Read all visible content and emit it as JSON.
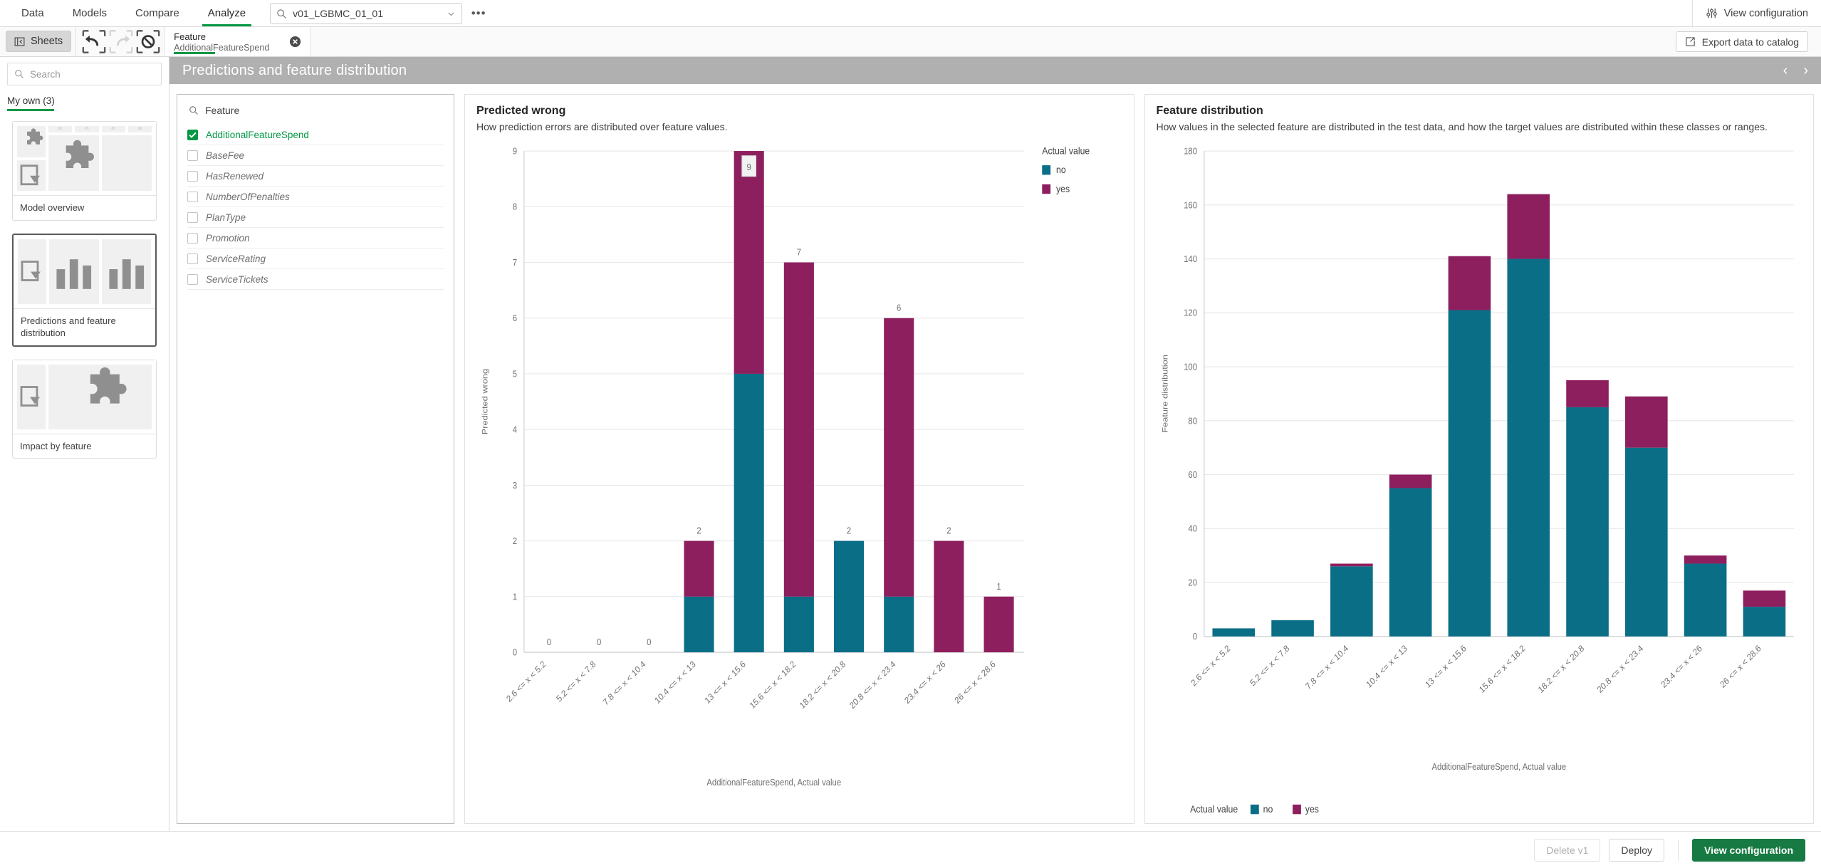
{
  "topbar": {
    "tabs": [
      {
        "label": "Data",
        "active": false
      },
      {
        "label": "Models",
        "active": false
      },
      {
        "label": "Compare",
        "active": false
      },
      {
        "label": "Analyze",
        "active": true
      }
    ],
    "model_select_value": "v01_LGBMC_01_01",
    "more_label": "•••",
    "view_configuration_label": "View configuration"
  },
  "secondbar": {
    "sheets_label": "Sheets",
    "selection_title": "Feature",
    "selection_value": "AdditionalFeatureSpend",
    "export_label": "Export data to catalog"
  },
  "sheetpanel": {
    "search_placeholder": "Search",
    "tab_label": "My own (3)",
    "sheets": [
      {
        "name": "Model overview"
      },
      {
        "name": "Predictions and feature distribution"
      },
      {
        "name": "Impact by feature"
      }
    ]
  },
  "sheet": {
    "title": "Predictions and feature distribution"
  },
  "feature_panel": {
    "header": "Feature",
    "items": [
      {
        "label": "AdditionalFeatureSpend",
        "selected": true
      },
      {
        "label": "BaseFee",
        "selected": false
      },
      {
        "label": "HasRenewed",
        "selected": false
      },
      {
        "label": "NumberOfPenalties",
        "selected": false
      },
      {
        "label": "PlanType",
        "selected": false
      },
      {
        "label": "Promotion",
        "selected": false
      },
      {
        "label": "ServiceRating",
        "selected": false
      },
      {
        "label": "ServiceTickets",
        "selected": false
      }
    ]
  },
  "colors": {
    "no": "#0a6e87",
    "yes": "#8e1f5e",
    "accent_green": "#009845",
    "primary_green": "#177a42"
  },
  "chart_data": [
    {
      "type": "bar",
      "id": "predicted-wrong",
      "title": "Predicted wrong",
      "subtitle": "How prediction errors are distributed over feature values.",
      "xlabel": "AdditionalFeatureSpend, Actual value",
      "ylabel": "Predicted wrong",
      "ylim": [
        0,
        9
      ],
      "yticks": [
        0,
        1,
        2,
        3,
        4,
        5,
        6,
        7,
        8,
        9
      ],
      "grid": true,
      "stacked": true,
      "legend": {
        "title": "Actual value",
        "position": "right",
        "entries": [
          "no",
          "yes"
        ]
      },
      "categories": [
        "2.6 <= x < 5.2",
        "5.2 <= x < 7.8",
        "7.8 <= x < 10.4",
        "10.4 <= x < 13",
        "13 <= x < 15.6",
        "15.6 <= x < 18.2",
        "18.2 <= x < 20.8",
        "20.8 <= x < 23.4",
        "23.4 <= x < 26",
        "26 <= x < 28.6"
      ],
      "series": [
        {
          "name": "no",
          "values": [
            0,
            0,
            0,
            1,
            5,
            1,
            2,
            1,
            0,
            0
          ]
        },
        {
          "name": "yes",
          "values": [
            0,
            0,
            0,
            1,
            4,
            6,
            0,
            5,
            2,
            1
          ]
        }
      ],
      "totals": [
        0,
        0,
        0,
        2,
        9,
        7,
        2,
        6,
        2,
        1
      ],
      "total_labels": [
        "0",
        "0",
        "0",
        "2",
        "9",
        "7",
        "2",
        "6",
        "2",
        "1"
      ]
    },
    {
      "type": "bar",
      "id": "feature-distribution",
      "title": "Feature distribution",
      "subtitle": "How values in the selected feature are distributed in the test data, and how the target values are distributed within these classes or ranges.",
      "xlabel": "AdditionalFeatureSpend, Actual value",
      "ylabel": "Feature distribution",
      "ylim": [
        0,
        180
      ],
      "yticks": [
        0,
        20,
        40,
        60,
        80,
        100,
        120,
        140,
        160,
        180
      ],
      "grid": true,
      "stacked": true,
      "legend": {
        "title": "Actual value",
        "position": "bottom",
        "entries": [
          "no",
          "yes"
        ]
      },
      "categories": [
        "2.6 <= x < 5.2",
        "5.2 <= x < 7.8",
        "7.8 <= x < 10.4",
        "10.4 <= x < 13",
        "13 <= x < 15.6",
        "15.6 <= x < 18.2",
        "18.2 <= x < 20.8",
        "20.8 <= x < 23.4",
        "23.4 <= x < 26",
        "26 <= x < 28.6"
      ],
      "series": [
        {
          "name": "no",
          "values": [
            3,
            6,
            26,
            55,
            121,
            140,
            85,
            70,
            27,
            11
          ]
        },
        {
          "name": "yes",
          "values": [
            0,
            0,
            1,
            5,
            20,
            24,
            10,
            19,
            3,
            6
          ]
        }
      ],
      "totals": [
        3,
        6,
        27,
        60,
        141,
        164,
        95,
        89,
        30,
        17
      ]
    }
  ],
  "footer": {
    "delete_label": "Delete v1",
    "deploy_label": "Deploy",
    "view_configuration_label": "View configuration"
  }
}
